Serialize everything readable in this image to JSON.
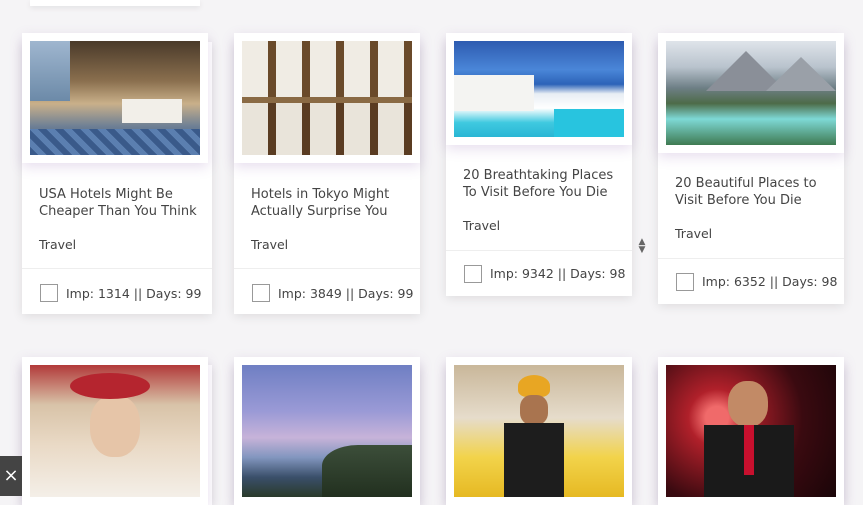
{
  "cards": [
    {
      "title": "USA Hotels Might Be Cheaper Than You Think",
      "category": "Travel",
      "stats": "Imp: 1314 || Days: 99"
    },
    {
      "title": "Hotels in Tokyo Might Actually Surprise You",
      "category": "Travel",
      "stats": "Imp: 3849 || Days: 99"
    },
    {
      "title": "20 Breathtaking Places To Visit Before You Die",
      "category": "Travel",
      "stats": "Imp: 9342 || Days: 98"
    },
    {
      "title": "20 Beautiful Places to Visit Before You Die",
      "category": "Travel",
      "stats": "Imp: 6352 || Days: 98"
    }
  ],
  "icons": {
    "sort": "sort-icon",
    "close": "close-icon"
  },
  "close_glyph": "×"
}
